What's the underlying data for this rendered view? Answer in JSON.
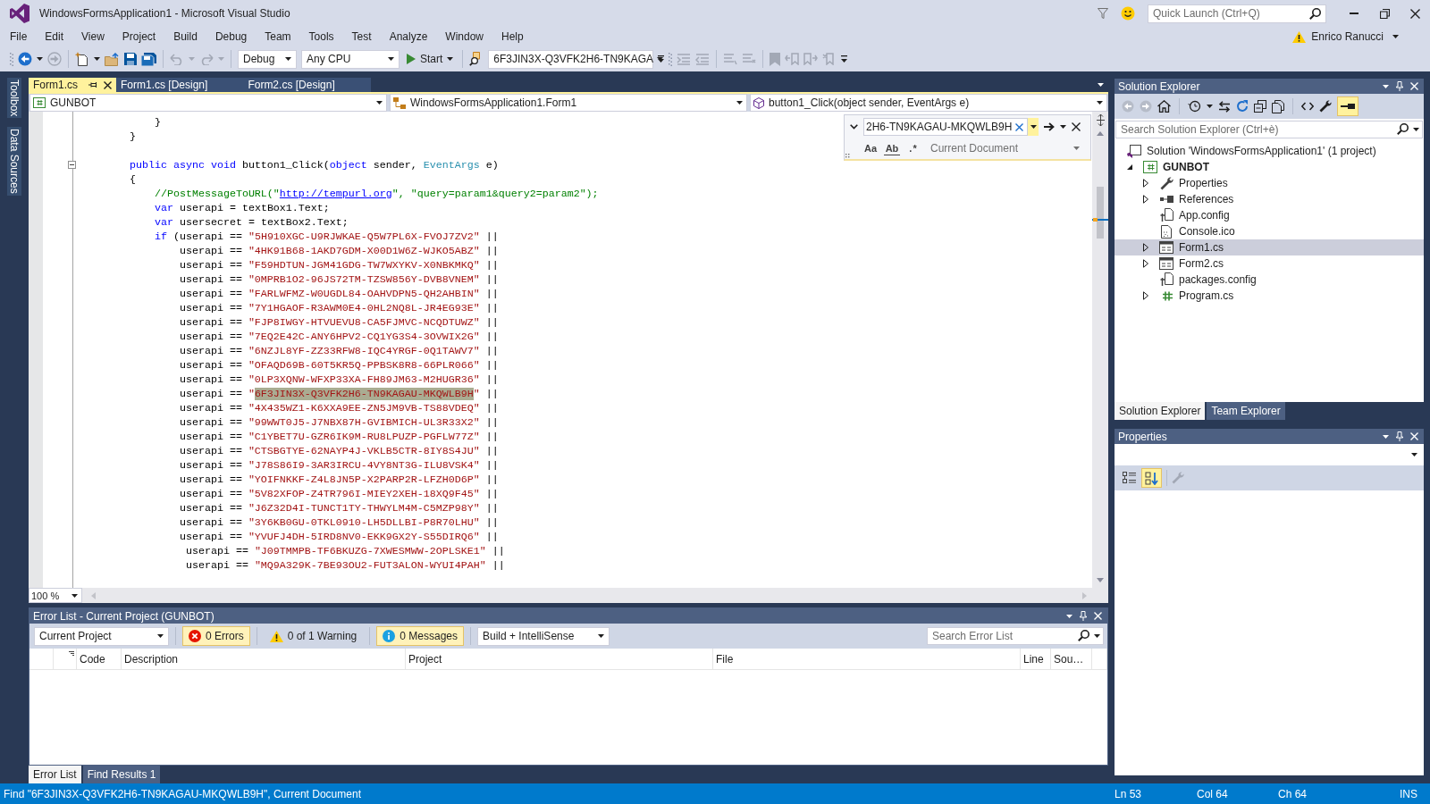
{
  "window": {
    "title": "WindowsFormsApplication1 - Microsoft Visual Studio",
    "quick_launch": {
      "placeholder": "Quick Launch (Ctrl+Q)"
    },
    "user": "Enrico Ranucci"
  },
  "menu": [
    "File",
    "Edit",
    "View",
    "Project",
    "Build",
    "Debug",
    "Team",
    "Tools",
    "Test",
    "Analyze",
    "Window",
    "Help"
  ],
  "toolbar": {
    "configuration": "Debug",
    "platform": "Any CPU",
    "start": "Start",
    "find": "6F3JIN3X-Q3VFK2H6-TN9KAGA"
  },
  "side_tabs": [
    "Toolbox",
    "Data Sources"
  ],
  "document_tabs": [
    {
      "label": "Form1.cs",
      "selected": true
    },
    {
      "label": "Form1.cs [Design]",
      "selected": false
    },
    {
      "label": "Form2.cs [Design]",
      "selected": false
    }
  ],
  "navigation_bar": [
    "GUNBOT",
    "WindowsFormsApplication1.Form1",
    "button1_Click(object sender, EventArgs e)"
  ],
  "editor": {
    "code_blocks": [
      [
        [
          {
            "kind": "plain",
            "text": "            }"
          }
        ],
        [
          {
            "kind": "plain",
            "text": "        }"
          }
        ]
      ],
      [
        [
          {
            "kind": "keyword",
            "text": "        public async void"
          },
          {
            "kind": "plain",
            "text": " button1_Click("
          },
          {
            "kind": "keyword",
            "text": "object"
          },
          {
            "kind": "plain",
            "text": " sender, "
          },
          {
            "kind": "type",
            "text": "EventArgs"
          },
          {
            "kind": "plain",
            "text": " e)"
          }
        ],
        [
          {
            "kind": "plain",
            "text": "        {"
          }
        ],
        [
          {
            "kind": "comment",
            "text": "            //PostMessageToURL(\""
          },
          {
            "kind": "link",
            "text": "http://tempurl.org"
          },
          {
            "kind": "comment",
            "text": "\", \"query=param1&query2=param2\");"
          }
        ],
        [
          {
            "kind": "keyword",
            "text": "            var"
          },
          {
            "kind": "plain",
            "text": " userapi = textBox1.Text;"
          }
        ],
        [
          {
            "kind": "keyword",
            "text": "            var"
          },
          {
            "kind": "plain",
            "text": " usersecret = textBox2.Text;"
          }
        ],
        [
          {
            "kind": "keyword",
            "text": "            if"
          },
          {
            "kind": "plain",
            "text": " (userapi == "
          },
          {
            "kind": "string",
            "text": "\"5H910XGC-U9RJWKAE-Q5W7PL6X-FVOJ7ZV2\""
          },
          {
            "kind": "plain",
            "text": " ||"
          }
        ],
        [
          {
            "kind": "plain",
            "text": "                userapi == "
          },
          {
            "kind": "string",
            "text": "\"4HK91B68-1AKD7GDM-X00D1W6Z-WJKO5ABZ\""
          },
          {
            "kind": "plain",
            "text": " ||"
          }
        ],
        [
          {
            "kind": "plain",
            "text": "                userapi == "
          },
          {
            "kind": "string",
            "text": "\"F59HDTUN-JGM41GDG-TW7WXYKV-X0NBKMKQ\""
          },
          {
            "kind": "plain",
            "text": " ||"
          }
        ],
        [
          {
            "kind": "plain",
            "text": "                userapi == "
          },
          {
            "kind": "string",
            "text": "\"0MPRB1O2-96JS72TM-TZSW856Y-DVB8VNEM\""
          },
          {
            "kind": "plain",
            "text": " ||"
          }
        ],
        [
          {
            "kind": "plain",
            "text": "                userapi == "
          },
          {
            "kind": "string",
            "text": "\"FARLWFMZ-W0UGDL84-OAHVDPN5-QH2AHBIN\""
          },
          {
            "kind": "plain",
            "text": " ||"
          }
        ],
        [
          {
            "kind": "plain",
            "text": "                userapi == "
          },
          {
            "kind": "string",
            "text": "\"7Y1HGAOF-R3AWM0E4-0HL2NQ8L-JR4EG93E\""
          },
          {
            "kind": "plain",
            "text": " ||"
          }
        ],
        [
          {
            "kind": "plain",
            "text": "                userapi == "
          },
          {
            "kind": "string",
            "text": "\"FJP8IWGY-HTVUEVU8-CA5FJMVC-NCQDTUWZ\""
          },
          {
            "kind": "plain",
            "text": " ||"
          }
        ],
        [
          {
            "kind": "plain",
            "text": "                userapi == "
          },
          {
            "kind": "string",
            "text": "\"7EQ2E42C-ANY6HPV2-CQ1YG3S4-3OVWIX2G\""
          },
          {
            "kind": "plain",
            "text": " ||"
          }
        ],
        [
          {
            "kind": "plain",
            "text": "                userapi == "
          },
          {
            "kind": "string",
            "text": "\"6NZJL8YF-ZZ33RFW8-IQC4YRGF-0Q1TAWV7\""
          },
          {
            "kind": "plain",
            "text": " ||"
          }
        ],
        [
          {
            "kind": "plain",
            "text": "                userapi == "
          },
          {
            "kind": "string",
            "text": "\"OFAQD69B-60T5KR5Q-PPBSK8R8-66PLR066\""
          },
          {
            "kind": "plain",
            "text": " ||"
          }
        ],
        [
          {
            "kind": "plain",
            "text": "                userapi == "
          },
          {
            "kind": "string",
            "text": "\"0LP3XQNW-WFXP33XA-FH89JM63-M2HUGR36\""
          },
          {
            "kind": "plain",
            "text": " ||"
          }
        ],
        [
          {
            "kind": "plain",
            "text": "                userapi == "
          },
          {
            "kind": "string",
            "text": "\""
          },
          {
            "kind": "match",
            "text": "6F3JIN3X-Q3VFK2H6-TN9KAGAU-MKQWLB9H"
          },
          {
            "kind": "string",
            "text": "\""
          },
          {
            "kind": "plain",
            "text": " ||"
          }
        ],
        [
          {
            "kind": "plain",
            "text": "                userapi == "
          },
          {
            "kind": "string",
            "text": "\"4X435WZ1-K6XXA9EE-ZN5JM9VB-TS88VDEQ\""
          },
          {
            "kind": "plain",
            "text": " ||"
          }
        ],
        [
          {
            "kind": "plain",
            "text": "                userapi == "
          },
          {
            "kind": "string",
            "text": "\"99WWT0J5-J7NBX87H-GVIBMICH-UL3R33X2\""
          },
          {
            "kind": "plain",
            "text": " ||"
          }
        ],
        [
          {
            "kind": "plain",
            "text": "                userapi == "
          },
          {
            "kind": "string",
            "text": "\"C1YBET7U-GZR6IK9M-RU8LPUZP-PGFLW77Z\""
          },
          {
            "kind": "plain",
            "text": " ||"
          }
        ],
        [
          {
            "kind": "plain",
            "text": "                userapi == "
          },
          {
            "kind": "string",
            "text": "\"CTSBGTYE-62NAYP4J-VKLB5CTR-8IY8S4JU\""
          },
          {
            "kind": "plain",
            "text": " ||"
          }
        ],
        [
          {
            "kind": "plain",
            "text": "                userapi == "
          },
          {
            "kind": "string",
            "text": "\"J78S86I9-3AR3IRCU-4VY8NT3G-ILU8VSK4\""
          },
          {
            "kind": "plain",
            "text": " ||"
          }
        ],
        [
          {
            "kind": "plain",
            "text": "                userapi == "
          },
          {
            "kind": "string",
            "text": "\"YOIFNKKF-Z4L8JN5P-X2PARP2R-LFZH0D6P\""
          },
          {
            "kind": "plain",
            "text": " ||"
          }
        ],
        [
          {
            "kind": "plain",
            "text": "                userapi == "
          },
          {
            "kind": "string",
            "text": "\"5V82XFOP-Z4TR796I-MIEY2XEH-18XQ9F45\""
          },
          {
            "kind": "plain",
            "text": " ||"
          }
        ],
        [
          {
            "kind": "plain",
            "text": "                userapi == "
          },
          {
            "kind": "string",
            "text": "\"J6Z32D4I-TUNCT1TY-THWYLM4M-C5MZP98Y\""
          },
          {
            "kind": "plain",
            "text": " ||"
          }
        ],
        [
          {
            "kind": "plain",
            "text": "                userapi == "
          },
          {
            "kind": "string",
            "text": "\"3Y6KB0GU-0TKL0910-LH5DLLBI-P8R70LHU\""
          },
          {
            "kind": "plain",
            "text": " ||"
          }
        ],
        [
          {
            "kind": "plain",
            "text": "                userapi == "
          },
          {
            "kind": "string",
            "text": "\"YVUFJ4DH-5IRD8NV0-EKK9GX2Y-S55DIRQ6\""
          },
          {
            "kind": "plain",
            "text": " ||"
          }
        ],
        [
          {
            "kind": "plain",
            "text": "                 userapi == "
          },
          {
            "kind": "string",
            "text": "\"J09TMMPB-TF6BKUZG-7XWESMWW-2OPLSKE1\""
          },
          {
            "kind": "plain",
            "text": " ||"
          }
        ],
        [
          {
            "kind": "plain",
            "text": "                 userapi == "
          },
          {
            "kind": "string",
            "text": "\"MQ9A329K-7BE93OU2-FUT3ALON-WYUI4PAH\""
          },
          {
            "kind": "plain",
            "text": " ||"
          }
        ]
      ]
    ],
    "find_widget": {
      "value": "2H6-TN9KAGAU-MKQWLB9H",
      "options": [
        {
          "kind": "case",
          "label": "Aa"
        },
        {
          "kind": "word",
          "label": "Ab"
        },
        {
          "kind": "regex",
          "label": ".*"
        }
      ],
      "scope": "Current Document"
    },
    "zoom": "100 %"
  },
  "error_list": {
    "title": "Error List - Current Project (GUNBOT)",
    "scope": "Current Project",
    "filters": [
      {
        "kind": "error",
        "label": "0 Errors",
        "selected": true
      },
      {
        "kind": "warning",
        "label": "0 of 1 Warning",
        "selected": false
      },
      {
        "kind": "message",
        "label": "0 Messages",
        "selected": true
      }
    ],
    "source": "Build + IntelliSense",
    "search": {
      "placeholder": "Search Error List"
    },
    "columns": [
      "Code",
      "Description",
      "Project",
      "File",
      "Line",
      "Sou…"
    ]
  },
  "panel_tabs": [
    {
      "label": "Error List",
      "selected": true
    },
    {
      "label": "Find Results 1",
      "selected": false
    }
  ],
  "solution_explorer": {
    "title": "Solution Explorer",
    "preview_selected_items": true,
    "search": {
      "placeholder": "Search Solution Explorer (Ctrl+è)"
    },
    "tree": [
      {
        "kind": "solution",
        "label": "Solution 'WindowsFormsApplication1' (1 project)",
        "selected": false,
        "children": [
          {
            "kind": "project",
            "label": "GUNBOT",
            "expanded": true,
            "selected": false,
            "children": [
              {
                "kind": "properties",
                "label": "Properties",
                "expanded": false,
                "selected": false
              },
              {
                "kind": "references",
                "label": "References",
                "expanded": false,
                "selected": false
              },
              {
                "kind": "config",
                "label": "App.config",
                "selected": false
              },
              {
                "kind": "icon_file",
                "label": "Console.ico",
                "selected": false
              },
              {
                "kind": "form",
                "label": "Form1.cs",
                "expanded": false,
                "selected": true
              },
              {
                "kind": "form",
                "label": "Form2.cs",
                "expanded": false,
                "selected": false
              },
              {
                "kind": "config",
                "label": "packages.config",
                "selected": false
              },
              {
                "kind": "csharp",
                "label": "Program.cs",
                "expanded": false,
                "selected": false
              }
            ]
          }
        ]
      }
    ],
    "tabs": [
      {
        "label": "Solution Explorer",
        "selected": true
      },
      {
        "label": "Team Explorer",
        "selected": false
      }
    ]
  },
  "properties": {
    "title": "Properties",
    "sort_buttons": [
      {
        "kind": "categorized",
        "selected": false
      },
      {
        "kind": "alphabetical",
        "selected": true
      }
    ]
  },
  "status_bar": {
    "message": "Find \"6F3JIN3X-Q3VFK2H6-TN9KAGAU-MKQWLB9H\", Current Document",
    "line": "Ln 53",
    "column": "Col 64",
    "char": "Ch 64",
    "mode": "INS"
  }
}
